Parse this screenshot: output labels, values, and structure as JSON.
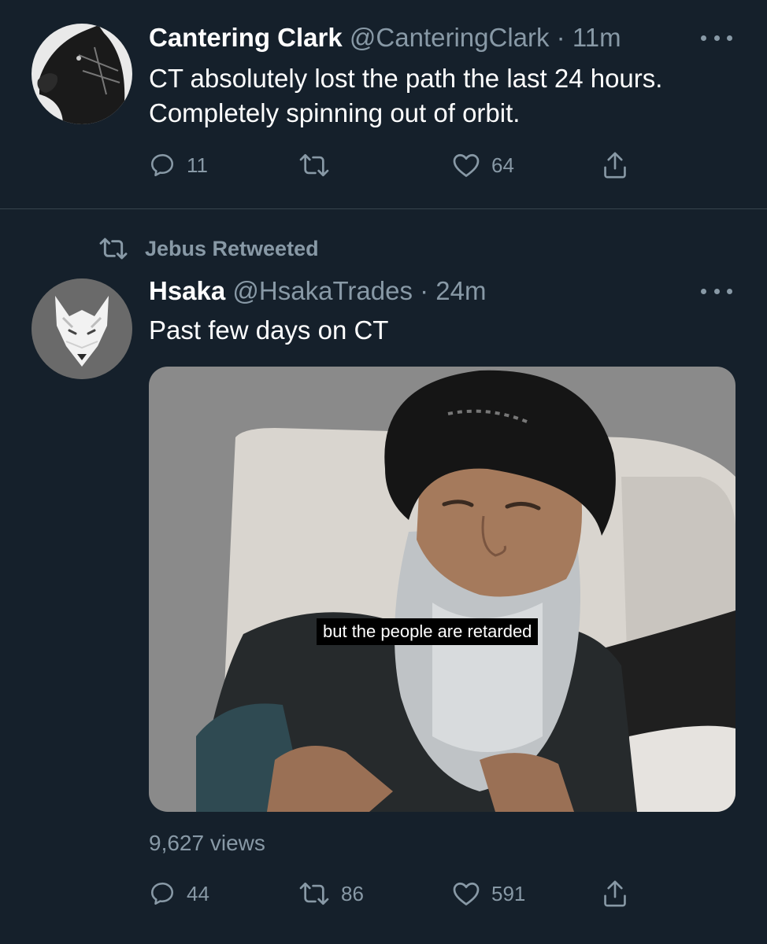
{
  "tweets": [
    {
      "display_name": "Cantering Clark",
      "handle": "@CanteringClark",
      "separator": "·",
      "time": "11m",
      "text": "CT absolutely lost the path the last 24 hours. Completely spinning out of orbit.",
      "replies": "11",
      "retweets": "",
      "likes": "64"
    },
    {
      "retweet_banner": "Jebus Retweeted",
      "display_name": "Hsaka",
      "handle": "@HsakaTrades",
      "separator": "·",
      "time": "24m",
      "text": "Past few days on CT",
      "media_subtitle": "but the people are retarded",
      "views": "9,627 views",
      "replies": "44",
      "retweets": "86",
      "likes": "591"
    }
  ],
  "icons": {
    "reply": "reply-icon",
    "retweet": "retweet-icon",
    "like": "heart-icon",
    "share": "share-icon",
    "more": "more-icon"
  },
  "colors": {
    "background": "#15202b",
    "secondary_text": "#8899a6",
    "primary_text": "#ffffff",
    "divider": "#38444d"
  }
}
